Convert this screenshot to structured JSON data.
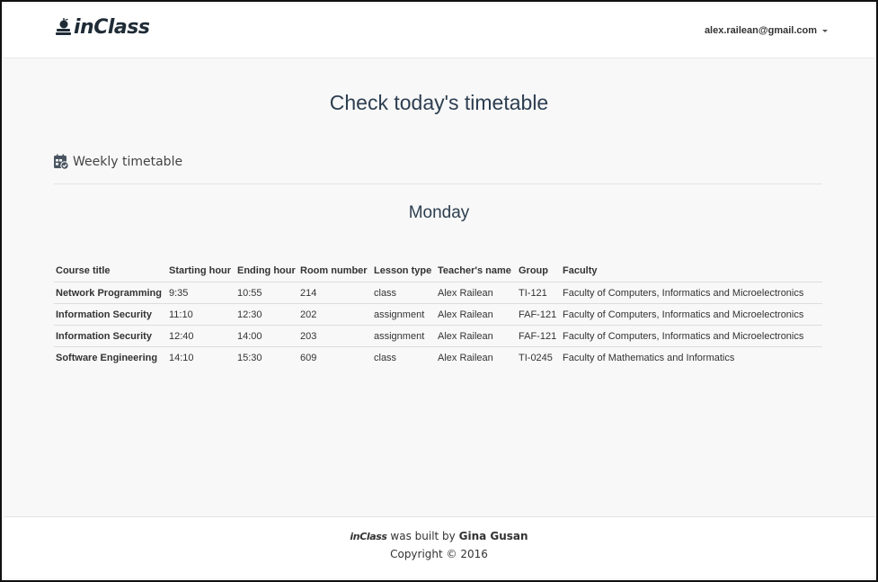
{
  "navbar": {
    "brand": "inClass",
    "user_email": "alex.railean@gmail.com"
  },
  "page": {
    "title": "Check today's timetable",
    "section_label": "Weekly timetable",
    "day": "Monday"
  },
  "table": {
    "headers": {
      "course_title": "Course title",
      "starting_hour": "Starting hour",
      "ending_hour": "Ending hour",
      "room_number": "Room number",
      "lesson_type": "Lesson type",
      "teacher_name": "Teacher's name",
      "group": "Group",
      "faculty": "Faculty"
    },
    "rows": [
      {
        "course_title": "Network Programming",
        "starting_hour": "9:35",
        "ending_hour": "10:55",
        "room_number": "214",
        "lesson_type": "class",
        "teacher_name": "Alex Railean",
        "group": "TI-121",
        "faculty": "Faculty of Computers, Informatics and Microelectronics"
      },
      {
        "course_title": "Information Security",
        "starting_hour": "11:10",
        "ending_hour": "12:30",
        "room_number": "202",
        "lesson_type": "assignment",
        "teacher_name": "Alex Railean",
        "group": "FAF-121",
        "faculty": "Faculty of Computers, Informatics and Microelectronics"
      },
      {
        "course_title": "Information Security",
        "starting_hour": "12:40",
        "ending_hour": "14:00",
        "room_number": "203",
        "lesson_type": "assignment",
        "teacher_name": "Alex Railean",
        "group": "FAF-121",
        "faculty": "Faculty of Computers, Informatics and Microelectronics"
      },
      {
        "course_title": "Software Engineering",
        "starting_hour": "14:10",
        "ending_hour": "15:30",
        "room_number": "609",
        "lesson_type": "class",
        "teacher_name": "Alex Railean",
        "group": "TI-0245",
        "faculty": "Faculty of Mathematics and Informatics"
      }
    ]
  },
  "footer": {
    "brand": "inClass",
    "built_by_text": "was built by",
    "author": "Gina Gusan",
    "copyright": "Copyright © 2016"
  },
  "icons": {
    "logo": "apple-on-books-icon",
    "section": "calendar-check-icon",
    "user_menu": "caret-down-icon"
  }
}
